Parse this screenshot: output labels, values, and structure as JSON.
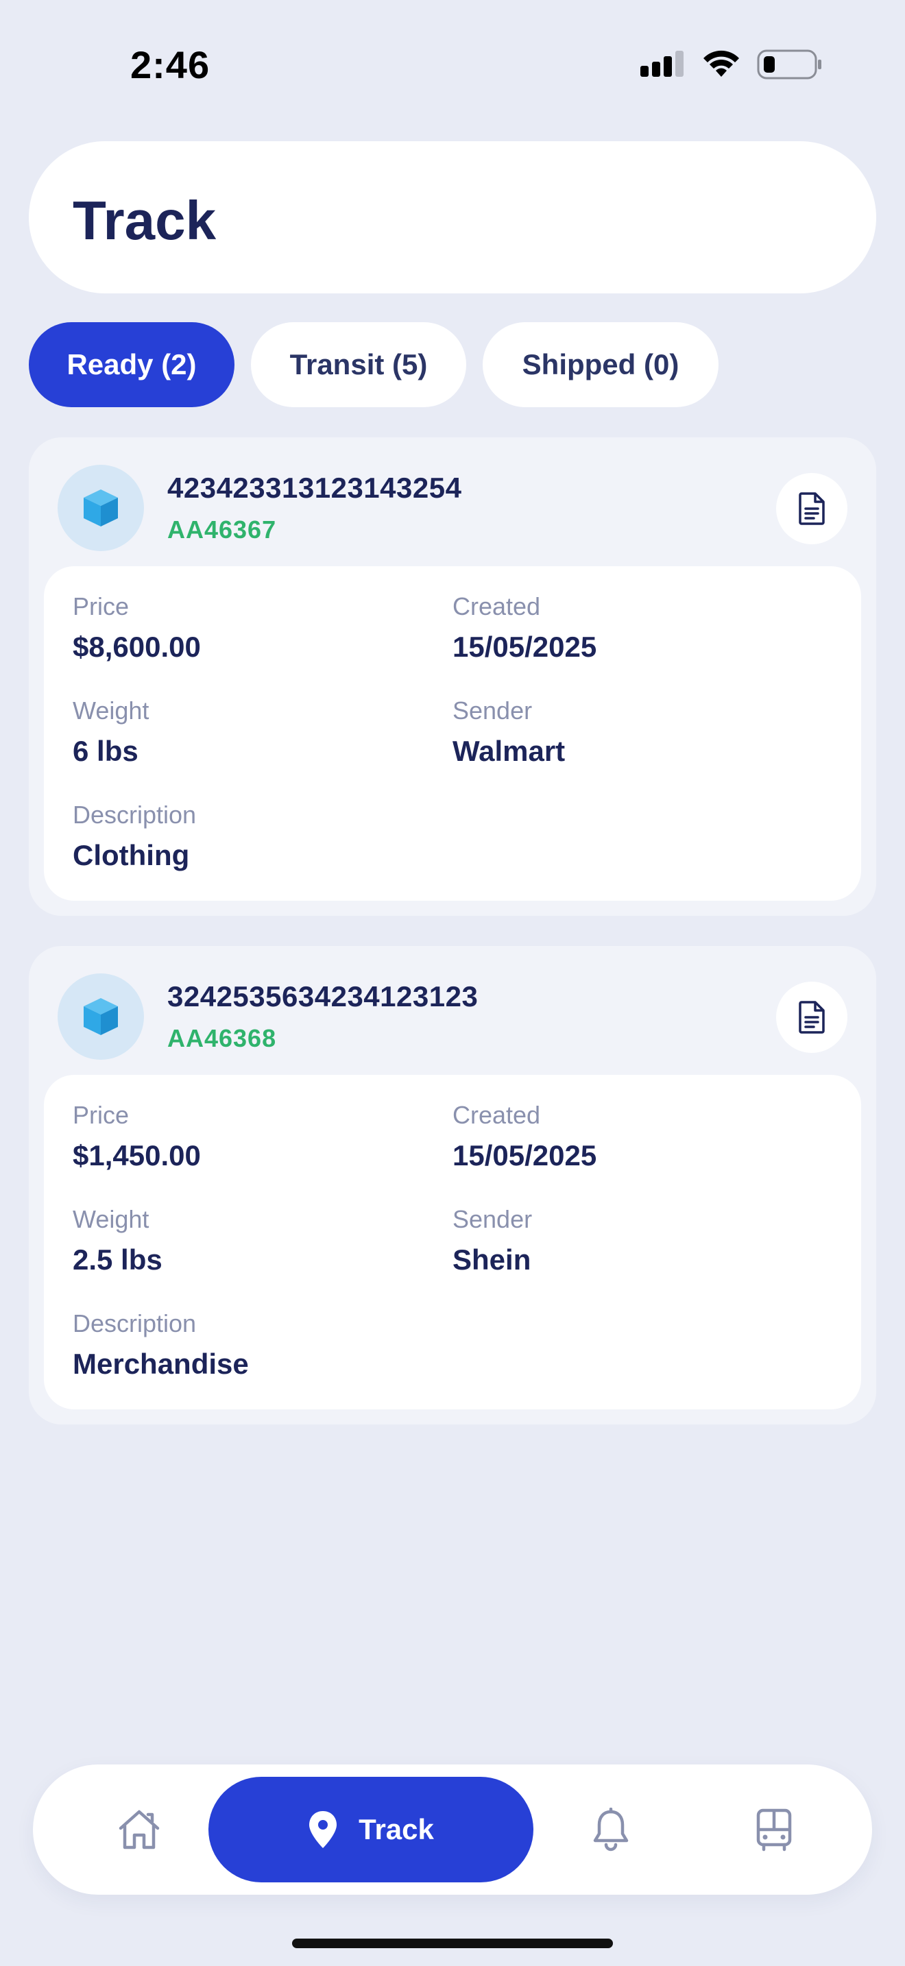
{
  "status_bar": {
    "time": "2:46"
  },
  "header": {
    "title": "Track"
  },
  "tabs": [
    {
      "label": "Ready (2)",
      "active": true
    },
    {
      "label": "Transit (5)",
      "active": false
    },
    {
      "label": "Shipped (0)",
      "active": false
    }
  ],
  "labels": {
    "price": "Price",
    "created": "Created",
    "weight": "Weight",
    "sender": "Sender",
    "description": "Description"
  },
  "shipments": [
    {
      "tracking_number": "423423313123143254",
      "code": "AA46367",
      "price": "$8,600.00",
      "created": "15/05/2025",
      "weight": "6 lbs",
      "sender": "Walmart",
      "description": "Clothing"
    },
    {
      "tracking_number": "3242535634234123123",
      "code": "AA46368",
      "price": "$1,450.00",
      "created": "15/05/2025",
      "weight": "2.5 lbs",
      "sender": "Shein",
      "description": "Merchandise"
    }
  ],
  "bottom_nav": {
    "items": [
      {
        "icon": "home-icon"
      },
      {
        "icon": "location-pin-icon",
        "label": "Track",
        "active": true
      },
      {
        "icon": "bell-icon"
      },
      {
        "icon": "bus-icon"
      }
    ]
  },
  "colors": {
    "accent": "#2740d6",
    "code_green": "#2fb36c",
    "background": "#e8ebf5",
    "text_dark": "#1c2459",
    "label_gray": "#8990ad",
    "package_blue": "#2fa8e6"
  }
}
